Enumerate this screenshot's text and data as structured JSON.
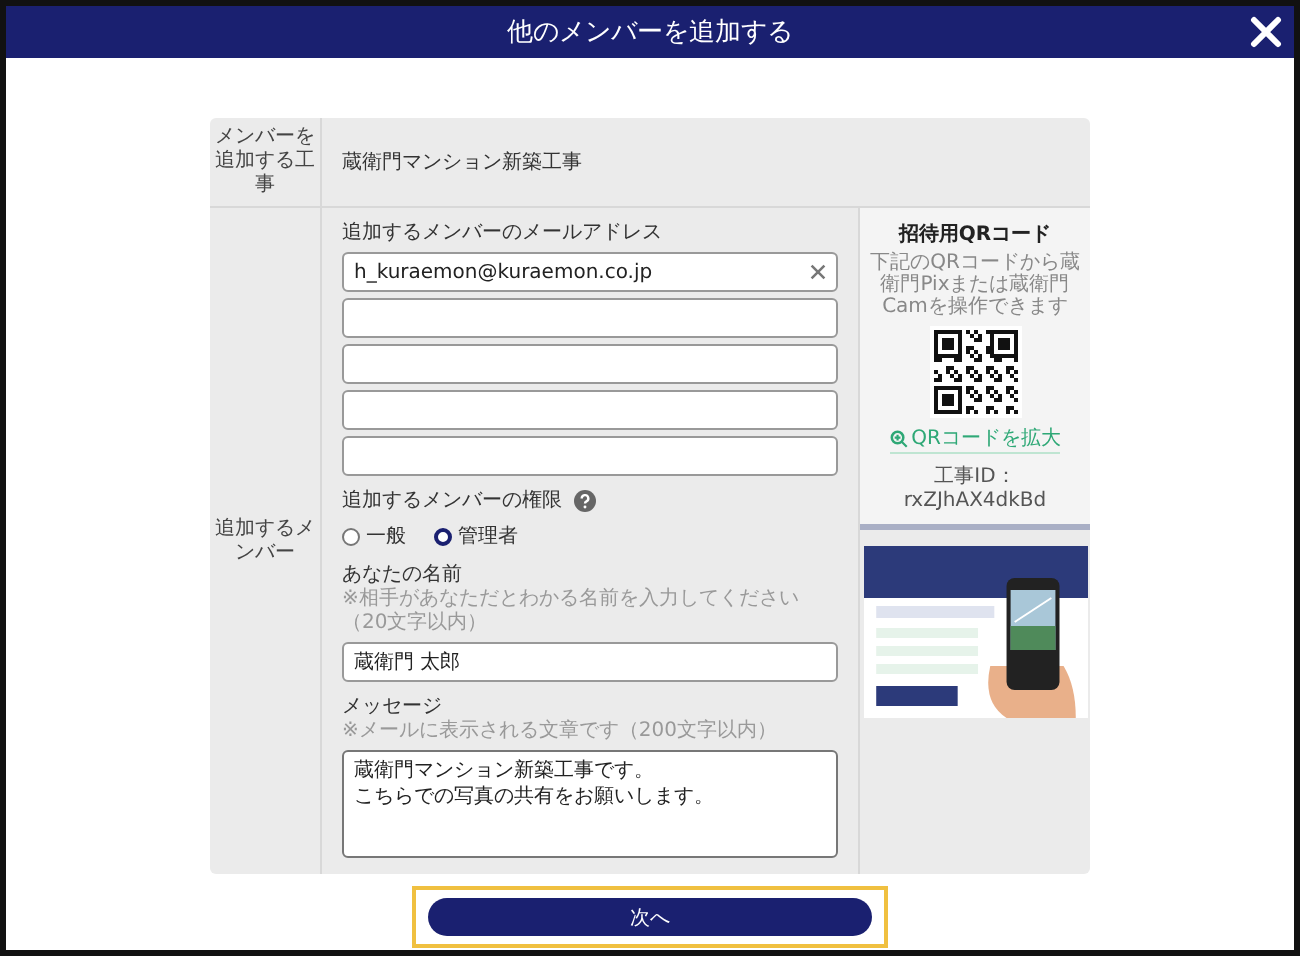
{
  "window": {
    "title": "他のメンバーを追加する"
  },
  "project": {
    "label": "メンバーを追加する工事",
    "value": "蔵衛門マンション新築工事"
  },
  "members": {
    "label": "追加するメンバー",
    "email_label": "追加するメンバーのメールアドレス",
    "email_fields": [
      {
        "value": "h_kuraemon@kuraemon.co.jp",
        "clearable": true
      },
      {
        "clearable": false
      },
      {
        "clearable": false
      },
      {
        "clearable": false
      },
      {
        "clearable": false
      }
    ],
    "role": {
      "label": "追加するメンバーの権限",
      "options": [
        {
          "label": "一般",
          "selected": false
        },
        {
          "label": "管理者",
          "selected": true
        }
      ]
    },
    "name": {
      "label": "あなたの名前",
      "hint": "※相手があなただとわかる名前を入力してください（20文字以内）",
      "value": "蔵衛門 太郎"
    },
    "message": {
      "label": "メッセージ",
      "hint": "※メールに表示される文章です（200文字以内）",
      "lines": [
        "蔵衛門マンション新築工事です。",
        "こちらでの写真の共有をお願いします。"
      ]
    }
  },
  "qr": {
    "title": "招待用QRコード",
    "description": "下記のQRコードから蔵衛門Pixまたは蔵衛門Camを操作できます",
    "link": "QRコードを拡大",
    "code": "工事ID：rxZJhAX4dkBd"
  },
  "next_button": "次へ"
}
